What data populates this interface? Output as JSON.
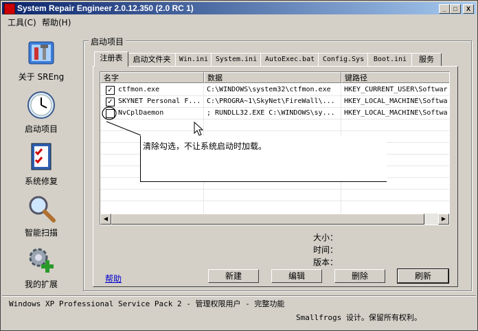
{
  "window": {
    "title": "System Repair Engineer 2.0.12.350 (2.0 RC 1)",
    "min_glyph": "_",
    "max_glyph": "□",
    "close_glyph": "X"
  },
  "menu": {
    "tools": "工具(C)",
    "help": "帮助(H)"
  },
  "sidebar": [
    {
      "label": "关于 SREng",
      "icon": "toolbox-icon"
    },
    {
      "label": "启动项目",
      "icon": "clock-icon"
    },
    {
      "label": "系统修复",
      "icon": "checklist-icon"
    },
    {
      "label": "智能扫描",
      "icon": "magnifier-icon"
    },
    {
      "label": "我的扩展",
      "icon": "gear-plus-icon"
    }
  ],
  "group_title": "启动项目",
  "tabs": [
    "注册表",
    "启动文件夹",
    "Win.ini",
    "System.ini",
    "AutoExec.bat",
    "Config.Sys",
    "Boot.ini",
    "服务"
  ],
  "active_tab": "注册表",
  "list": {
    "headers": [
      "名字",
      "数据",
      "键路径"
    ],
    "rows": [
      {
        "checked": true,
        "name": "ctfmon.exe",
        "data": "C:\\WINDOWS\\system32\\ctfmon.exe",
        "key": "HKEY_CURRENT_USER\\Softwar"
      },
      {
        "checked": true,
        "name": "SKYNET Personal F...",
        "data": "C:\\PROGRA~1\\SkyNet\\FireWall\\...",
        "key": "HKEY_LOCAL_MACHINE\\Softwa"
      },
      {
        "checked": false,
        "name": "NvCplDaemon",
        "data": "; RUNDLL32.EXE C:\\WINDOWS\\sy...",
        "key": "HKEY_LOCAL_MACHINE\\Softwa"
      }
    ],
    "check_glyph": "✓"
  },
  "callout_text": "清除勾选，不让系统启动时加载。",
  "info": {
    "size_label": "大小：",
    "time_label": "时间：",
    "version_label": "版本："
  },
  "help_link": "帮助",
  "buttons": {
    "new": "新建",
    "edit": "编辑",
    "delete": "删除",
    "refresh": "刷新"
  },
  "status": {
    "line1": "Windows XP Professional Service Pack 2 - 管理权限用户 - 完整功能",
    "line2": "Smallfrogs 设计。保留所有权利。"
  },
  "colors": {
    "titlebar_start": "#0a246a",
    "titlebar_end": "#a6caf0",
    "face": "#d4d0c8",
    "link": "#0000cc"
  }
}
